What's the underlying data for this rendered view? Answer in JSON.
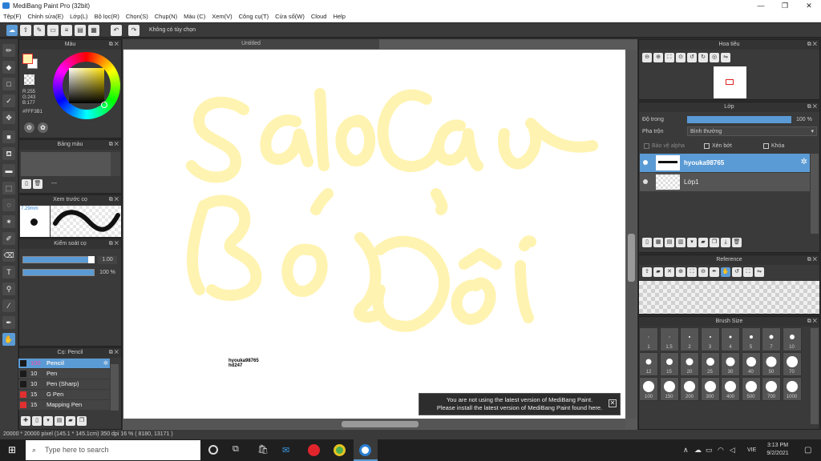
{
  "app": {
    "title": "MediBang Paint Pro (32bit)"
  },
  "menu": [
    "Tệp(F)",
    "Chỉnh sửa(E)",
    "Lớp(L)",
    "Bộ lọc(R)",
    "Chọn(S)",
    "Chụp(N)",
    "Màu (C)",
    "Xem(V)",
    "Công cụ(T)",
    "Cửa sổ(W)",
    "Cloud",
    "Help"
  ],
  "toolbar": {
    "selection_label": "Không có tùy chọn"
  },
  "color_panel": {
    "title": "Màu",
    "r": "R:255",
    "g": "G:243",
    "b": "B:177",
    "hex": "#FFF3B1"
  },
  "palette_panel": {
    "title": "Bảng màu",
    "dash": "---"
  },
  "brush_preview": {
    "title": "Xem trước cọ",
    "size": "7.29mm"
  },
  "brush_control": {
    "title": "Kiểm soát cọ",
    "size_val": "1.00",
    "opacity_val": "100 %"
  },
  "brush_list": {
    "title": "Cọ: Pencil",
    "items": [
      {
        "size": "100",
        "name": "Pencil",
        "color": "#1a1a1a",
        "selected": true
      },
      {
        "size": "10",
        "name": "Pen",
        "color": "#1a1a1a"
      },
      {
        "size": "10",
        "name": "Pen (Sharp)",
        "color": "#1a1a1a"
      },
      {
        "size": "15",
        "name": "G Pen",
        "color": "#e03030"
      },
      {
        "size": "15",
        "name": "Mapping Pen",
        "color": "#e03030"
      }
    ]
  },
  "document": {
    "tab": "Untitled",
    "canvas_text_1": "hyouka98765",
    "canvas_text_2": "hd247"
  },
  "notice": {
    "line1": "You are not using the latest version of MediBang Paint.",
    "line2": "Please install the latest version of MediBang Paint found here."
  },
  "status": {
    "text": "20000 * 20000 pixel  (145.1 * 145.1cm)  350 dpi  16 %  ( 8180, 13171 )"
  },
  "navigator": {
    "title": "Hoa tiêu"
  },
  "layer_panel": {
    "title": "Lớp",
    "opacity_label": "Độ trong",
    "opacity_value": "100 %",
    "blend_label": "Pha trộn",
    "blend_value": "Bình thường",
    "protect_alpha": "Bảo vệ alpha",
    "clipping": "Xén bớt",
    "lock": "Khóa",
    "layers": [
      {
        "name": "hyouka98765",
        "selected": true
      },
      {
        "name": "Lớp1",
        "selected": false
      }
    ]
  },
  "reference": {
    "title": "Reference"
  },
  "brush_size": {
    "title": "Brush Size",
    "sizes": [
      "1",
      "1.5",
      "2",
      "3",
      "4",
      "5",
      "7",
      "10",
      "12",
      "15",
      "20",
      "25",
      "30",
      "40",
      "50",
      "70",
      "100",
      "150",
      "200",
      "300",
      "400",
      "500",
      "700",
      "1000"
    ]
  },
  "taskbar": {
    "search_placeholder": "Type here to search",
    "lang": "VIE",
    "time": "3:13 PM",
    "date": "9/2/2021"
  },
  "colors": {
    "stroke": "#FFF3B1",
    "accent": "#5b9bd5"
  }
}
